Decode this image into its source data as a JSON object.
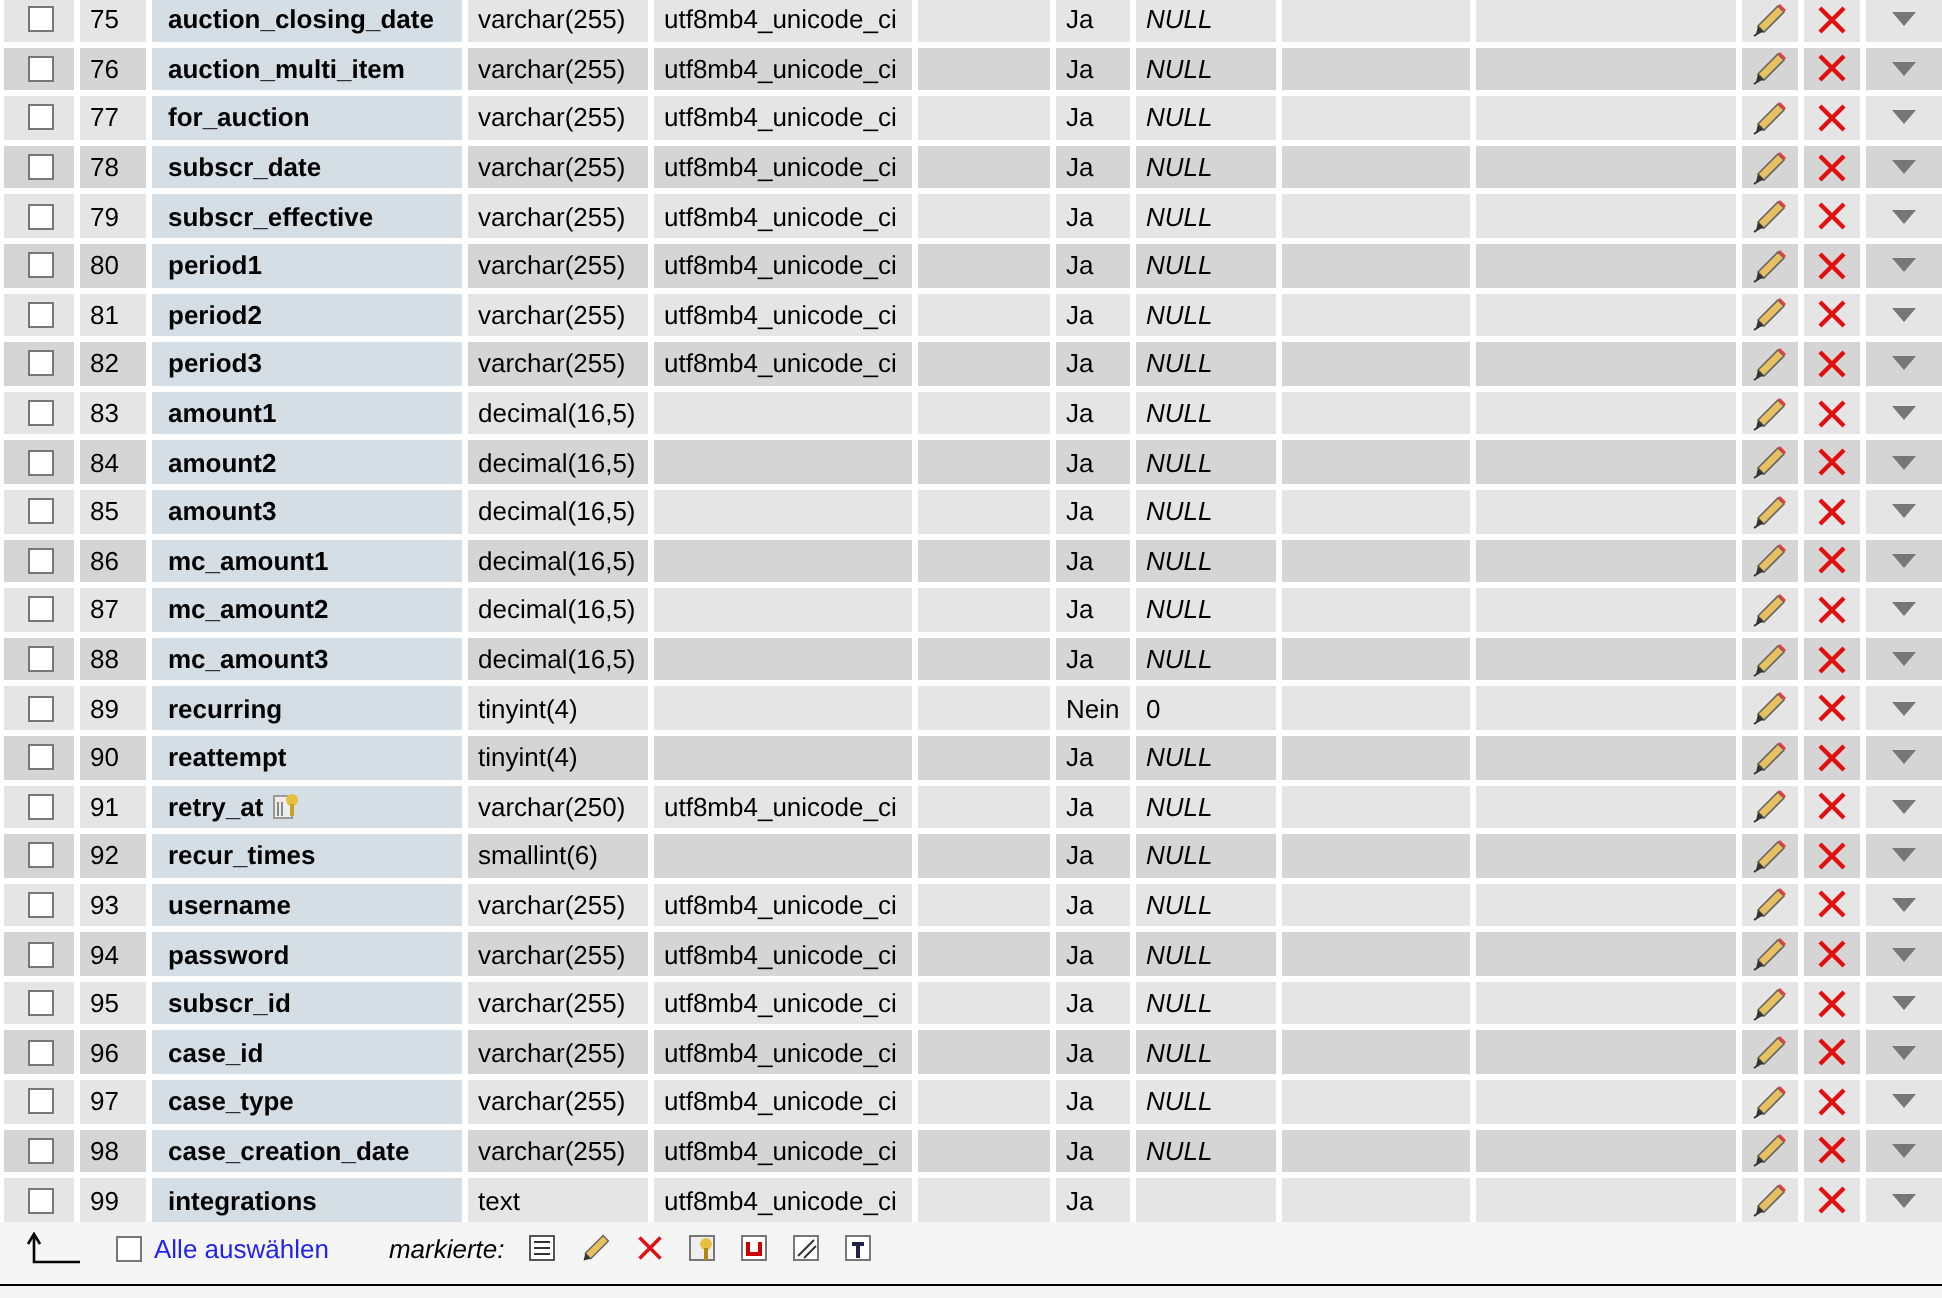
{
  "rows": [
    {
      "checked": false,
      "number": "75",
      "name": "auction_closing_date",
      "indexed": false,
      "type": "varchar(255)",
      "collation": "utf8mb4_unicode_ci",
      "null": "Ja",
      "default": "NULL",
      "default_null": true
    },
    {
      "checked": false,
      "number": "76",
      "name": "auction_multi_item",
      "indexed": false,
      "type": "varchar(255)",
      "collation": "utf8mb4_unicode_ci",
      "null": "Ja",
      "default": "NULL",
      "default_null": true
    },
    {
      "checked": false,
      "number": "77",
      "name": "for_auction",
      "indexed": false,
      "type": "varchar(255)",
      "collation": "utf8mb4_unicode_ci",
      "null": "Ja",
      "default": "NULL",
      "default_null": true
    },
    {
      "checked": false,
      "number": "78",
      "name": "subscr_date",
      "indexed": false,
      "type": "varchar(255)",
      "collation": "utf8mb4_unicode_ci",
      "null": "Ja",
      "default": "NULL",
      "default_null": true
    },
    {
      "checked": false,
      "number": "79",
      "name": "subscr_effective",
      "indexed": false,
      "type": "varchar(255)",
      "collation": "utf8mb4_unicode_ci",
      "null": "Ja",
      "default": "NULL",
      "default_null": true
    },
    {
      "checked": false,
      "number": "80",
      "name": "period1",
      "indexed": false,
      "type": "varchar(255)",
      "collation": "utf8mb4_unicode_ci",
      "null": "Ja",
      "default": "NULL",
      "default_null": true
    },
    {
      "checked": false,
      "number": "81",
      "name": "period2",
      "indexed": false,
      "type": "varchar(255)",
      "collation": "utf8mb4_unicode_ci",
      "null": "Ja",
      "default": "NULL",
      "default_null": true
    },
    {
      "checked": false,
      "number": "82",
      "name": "period3",
      "indexed": false,
      "type": "varchar(255)",
      "collation": "utf8mb4_unicode_ci",
      "null": "Ja",
      "default": "NULL",
      "default_null": true
    },
    {
      "checked": false,
      "number": "83",
      "name": "amount1",
      "indexed": false,
      "type": "decimal(16,5)",
      "null": "Ja",
      "default": "NULL",
      "default_null": true
    },
    {
      "checked": false,
      "number": "84",
      "name": "amount2",
      "indexed": false,
      "type": "decimal(16,5)",
      "null": "Ja",
      "default": "NULL",
      "default_null": true
    },
    {
      "checked": false,
      "number": "85",
      "name": "amount3",
      "indexed": false,
      "type": "decimal(16,5)",
      "null": "Ja",
      "default": "NULL",
      "default_null": true
    },
    {
      "checked": false,
      "number": "86",
      "name": "mc_amount1",
      "indexed": false,
      "type": "decimal(16,5)",
      "null": "Ja",
      "default": "NULL",
      "default_null": true
    },
    {
      "checked": false,
      "number": "87",
      "name": "mc_amount2",
      "indexed": false,
      "type": "decimal(16,5)",
      "null": "Ja",
      "default": "NULL",
      "default_null": true
    },
    {
      "checked": false,
      "number": "88",
      "name": "mc_amount3",
      "indexed": false,
      "type": "decimal(16,5)",
      "null": "Ja",
      "default": "NULL",
      "default_null": true
    },
    {
      "checked": false,
      "number": "89",
      "name": "recurring",
      "indexed": false,
      "type": "tinyint(4)",
      "null": "Nein",
      "default": "0",
      "default_null": false
    },
    {
      "checked": false,
      "number": "90",
      "name": "reattempt",
      "indexed": false,
      "type": "tinyint(4)",
      "null": "Ja",
      "default": "NULL",
      "default_null": true
    },
    {
      "checked": false,
      "number": "91",
      "name": "retry_at",
      "indexed": true,
      "type": "varchar(250)",
      "collation": "utf8mb4_unicode_ci",
      "null": "Ja",
      "default": "NULL",
      "default_null": true
    },
    {
      "checked": false,
      "number": "92",
      "name": "recur_times",
      "indexed": false,
      "type": "smallint(6)",
      "null": "Ja",
      "default": "NULL",
      "default_null": true
    },
    {
      "checked": false,
      "number": "93",
      "name": "username",
      "indexed": false,
      "type": "varchar(255)",
      "collation": "utf8mb4_unicode_ci",
      "null": "Ja",
      "default": "NULL",
      "default_null": true
    },
    {
      "checked": false,
      "number": "94",
      "name": "password",
      "indexed": false,
      "type": "varchar(255)",
      "collation": "utf8mb4_unicode_ci",
      "null": "Ja",
      "default": "NULL",
      "default_null": true
    },
    {
      "checked": false,
      "number": "95",
      "name": "subscr_id",
      "indexed": false,
      "type": "varchar(255)",
      "collation": "utf8mb4_unicode_ci",
      "null": "Ja",
      "default": "NULL",
      "default_null": true
    },
    {
      "checked": false,
      "number": "96",
      "name": "case_id",
      "indexed": false,
      "type": "varchar(255)",
      "collation": "utf8mb4_unicode_ci",
      "null": "Ja",
      "default": "NULL",
      "default_null": true
    },
    {
      "checked": false,
      "number": "97",
      "name": "case_type",
      "indexed": false,
      "type": "varchar(255)",
      "collation": "utf8mb4_unicode_ci",
      "null": "Ja",
      "default": "NULL",
      "default_null": true
    },
    {
      "checked": false,
      "number": "98",
      "name": "case_creation_date",
      "indexed": false,
      "type": "varchar(255)",
      "collation": "utf8mb4_unicode_ci",
      "null": "Ja",
      "default": "NULL",
      "default_null": true
    },
    {
      "checked": false,
      "number": "99",
      "name": "integrations",
      "indexed": false,
      "type": "text",
      "collation": "utf8mb4_unicode_ci",
      "null": "Ja"
    }
  ],
  "footer": {
    "select_all_checked": false,
    "select_all": "Alle auswählen",
    "with_selected": "markierte:"
  }
}
